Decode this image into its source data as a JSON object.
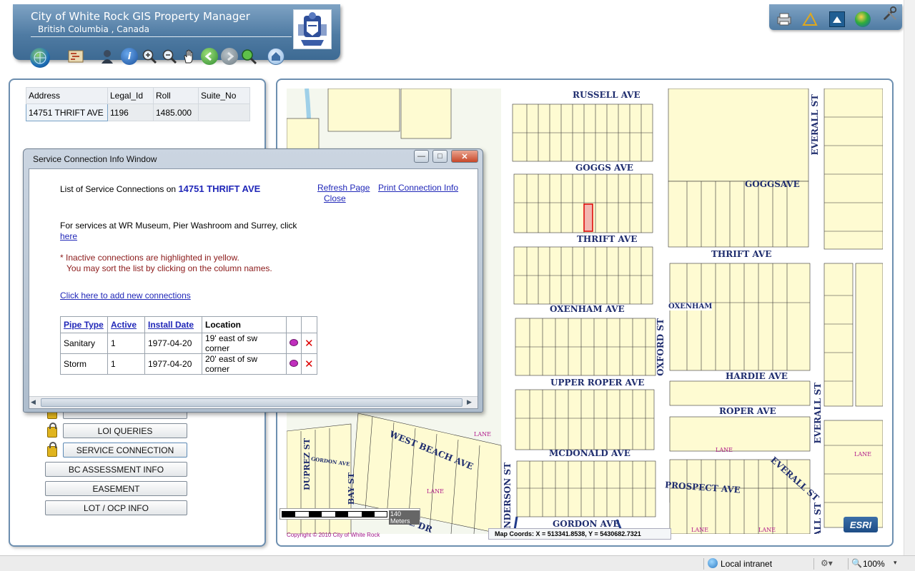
{
  "header": {
    "title": "City of White Rock GIS Property Manager",
    "subtitle": "British Columbia , Canada"
  },
  "property_table": {
    "columns": [
      "Address",
      "Legal_Id",
      "Roll",
      "Suite_No"
    ],
    "rows": [
      [
        "14751 THRIFT AVE",
        "1196",
        "1485.000",
        ""
      ]
    ]
  },
  "side_buttons": {
    "loi_queries": "LOI QUERIES",
    "service_connection": "SERVICE CONNECTION",
    "bc_assessment": "BC ASSESSMENT INFO",
    "easement": "EASEMENT",
    "lot_ocp": "LOT / OCP INFO"
  },
  "dialog": {
    "title": "Service Connection Info Window",
    "list_prefix": "List of Service Connections on",
    "address": "14751 THRIFT AVE",
    "refresh_link": "Refresh Page",
    "print_link": "Print Connection Info",
    "close_link": "Close",
    "services_text": "For services at WR Museum, Pier Washroom and Surrey, click",
    "here_link": "here",
    "inactive_note": "* Inactive connections are highlighted in yellow.",
    "sort_note": "You may sort the list by clicking on the column names.",
    "add_link": "Click here to add new connections",
    "table": {
      "columns": [
        "Pipe Type",
        "Active",
        "Install Date",
        "Location"
      ],
      "rows": [
        [
          "Sanitary",
          "1",
          "1977-04-20",
          "19' east of sw corner"
        ],
        [
          "Storm",
          "1",
          "1977-04-20",
          "20' east of sw corner"
        ]
      ]
    }
  },
  "map": {
    "streets": {
      "russell": "RUSSELL AVE",
      "goggs1": "GOGGS AVE",
      "goggs2": "GOGGSAVE",
      "thrift1": "THRIFT AVE",
      "thrift2": "THRIFT AVE",
      "oxenham": "OXENHAM AVE",
      "oxenham2": "OXENHAM",
      "upper_roper": "UPPER ROPER AVE",
      "hardie": "HARDIE AVE",
      "roper": "ROPER AVE",
      "mcdonald": "MCDONALD AVE",
      "prospect": "PROSPECT AVE",
      "gordon": "GORDON AVE",
      "west_beach": "WEST BEACH AVE",
      "everall_top": "EVERALL ST",
      "everall_mid": "EVERALL ST",
      "everall_diag": "EVERALL ST",
      "everall_bot": "ALL ST",
      "oxford": "OXFORD ST",
      "anderson": "ANDERSON ST",
      "duprez": "DUPREZ ST",
      "bay": "BAY ST",
      "gordon_dr": "NE DR",
      "gordon_lane": "GORDON AVE",
      "lane": "LANE"
    },
    "scale_label": "140 Meters",
    "copyright": "Copyright © 2010 City of White Rock",
    "coords": "Map Coords: X = 513341.8538, Y = 5430682.7321",
    "esri": "ESRI"
  },
  "statusbar": {
    "zone": "Local intranet",
    "zoom": "100%"
  },
  "icons": {
    "toolbar": [
      "globe-icon",
      "map-icon",
      "identify-person-icon",
      "info-icon",
      "zoom-in-icon",
      "zoom-out-icon",
      "pan-hand-icon",
      "back-icon",
      "forward-icon",
      "zoom-extent-icon",
      "home-icon"
    ],
    "tools": [
      "print-icon",
      "measure-icon",
      "bookmark-icon",
      "globe-icon",
      "tools-icon"
    ]
  }
}
